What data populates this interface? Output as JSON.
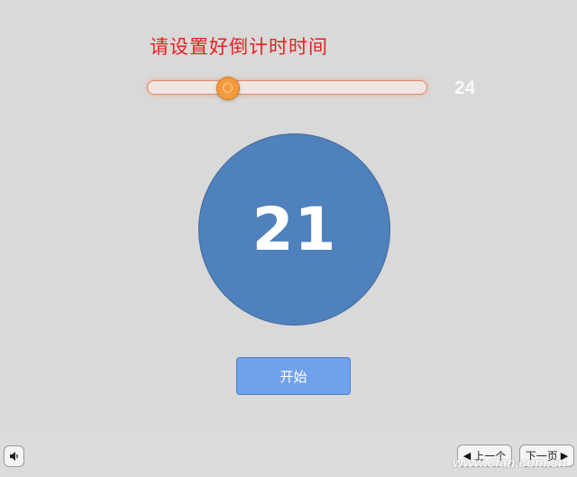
{
  "title": "请设置好倒计时时间",
  "slider": {
    "value": "24",
    "fraction": 0.28
  },
  "countdown": {
    "value": "21"
  },
  "start_button": {
    "label": "开始"
  },
  "nav": {
    "prev_label": "上一个",
    "next_label": "下一页"
  },
  "watermark": "www.cfan.com.cn",
  "colors": {
    "title": "#e8201e",
    "circle": "#4f81bd",
    "button": "#6fa2ea",
    "slider_knob": "#f29a3c"
  },
  "icons": [
    "speaker-icon",
    "chevron-left-icon",
    "chevron-right-icon"
  ]
}
